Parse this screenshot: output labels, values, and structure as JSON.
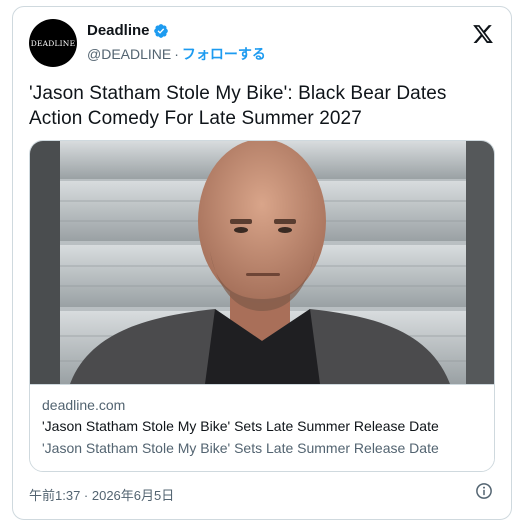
{
  "account": {
    "avatar_text": "DEADLINE",
    "name": "Deadline",
    "handle": "@DEADLINE",
    "separator": "·",
    "follow_label": "フォローする"
  },
  "post": {
    "text_line1": "'Jason Statham Stole My Bike': Black Bear Dates",
    "text_line2": "Action Comedy For Late Summer 2027"
  },
  "link_card": {
    "domain": "deadline.com",
    "title": "'Jason Statham Stole My Bike' Sets Late Summer Release Date",
    "description": "'Jason Statham Stole My Bike' Sets Late Summer Release Date"
  },
  "timestamp": "午前1:37 · 2026年6月5日",
  "colors": {
    "accent": "#1d9bf0",
    "secondary_text": "#536471",
    "border": "#cfd9de"
  },
  "icons": [
    "verified-badge-icon",
    "x-logo-icon",
    "info-icon"
  ]
}
